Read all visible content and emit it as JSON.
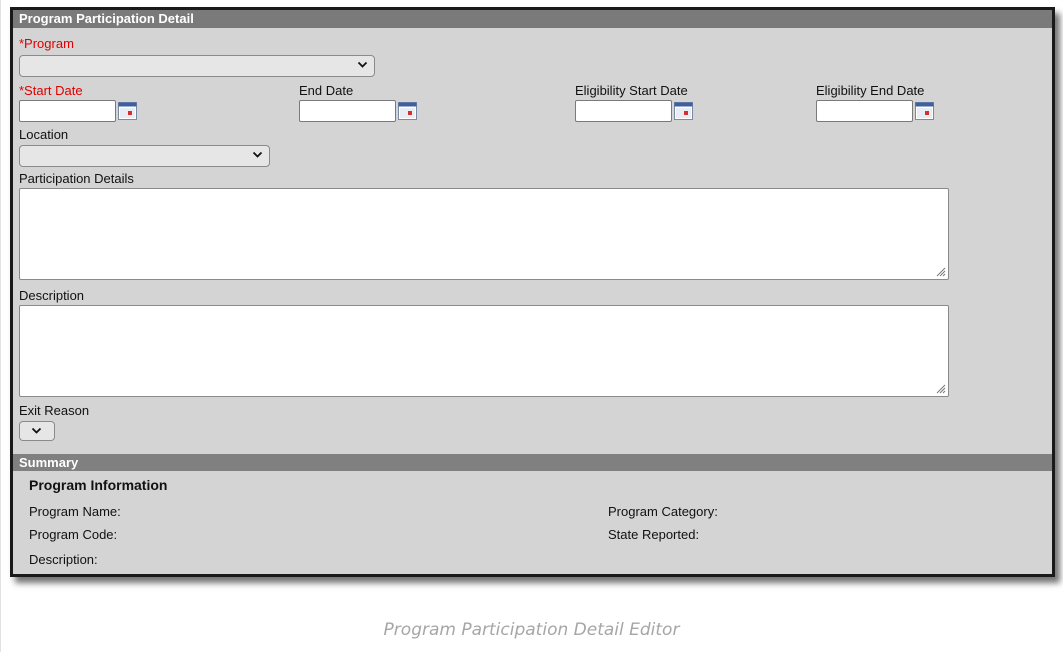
{
  "editor": {
    "header_title": "Program Participation Detail",
    "fields": {
      "program_label": "*Program",
      "program_value": "",
      "start_date_label": "*Start Date",
      "start_date_value": "",
      "end_date_label": "End Date",
      "end_date_value": "",
      "elig_start_label": "Eligibility Start Date",
      "elig_start_value": "",
      "elig_end_label": "Eligibility End Date",
      "elig_end_value": "",
      "location_label": "Location",
      "location_value": "",
      "participation_details_label": "Participation Details",
      "participation_details_value": "",
      "description_label": "Description",
      "description_value": "",
      "exit_reason_label": "Exit Reason",
      "exit_reason_value": ""
    },
    "summary": {
      "header_title": "Summary",
      "section_title": "Program Information",
      "program_name_label": "Program Name:",
      "program_code_label": "Program Code:",
      "description_label": "Description:",
      "program_category_label": "Program Category:",
      "state_reported_label": "State Reported:"
    }
  },
  "caption": "Program Participation Detail Editor",
  "icons": {
    "dropdown": "chevron-down-icon",
    "calendar": "calendar-icon",
    "resize": "resize-grip-icon"
  },
  "colors": {
    "required_label": "#e00000",
    "header_bar": "#7a7a7a",
    "panel_background": "#d4d4d4"
  }
}
